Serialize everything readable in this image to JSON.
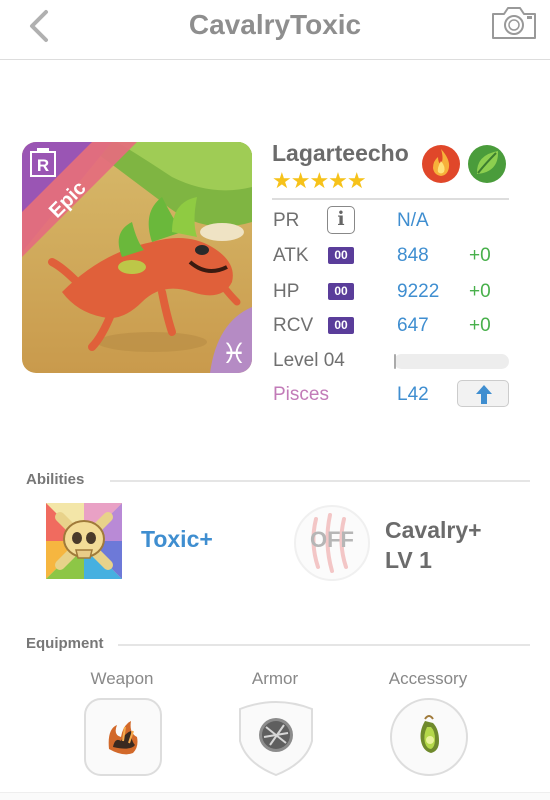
{
  "header": {
    "title": "CavalryToxic"
  },
  "monster": {
    "name": "Lagarteecho",
    "stars": "★★★★★",
    "rarity": "Epic",
    "book_badge": "R",
    "elements": [
      "fire-icon",
      "nature-icon"
    ],
    "element_colors": {
      "fire": "#e0472a",
      "nature": "#4a9c3b"
    }
  },
  "stats": {
    "pr": {
      "label": "PR",
      "info": "i",
      "value": "N/A"
    },
    "atk": {
      "label": "ATK",
      "badge": "00",
      "value": "848",
      "bonus": "+0"
    },
    "hp": {
      "label": "HP",
      "badge": "00",
      "value": "9222",
      "bonus": "+0"
    },
    "rcv": {
      "label": "RCV",
      "badge": "00",
      "value": "647",
      "bonus": "+0"
    },
    "level": {
      "label": "Level 04",
      "progress_fraction": 0.02
    },
    "sign": {
      "label": "Pisces",
      "value": "L42"
    }
  },
  "abilities": {
    "section_label": "Abilities",
    "skill_name": "Toxic+",
    "leader_status": "OFF",
    "leader_name": "Cavalry+\nLV 1"
  },
  "equipment": {
    "section_label": "Equipment",
    "slots": [
      {
        "label": "Weapon"
      },
      {
        "label": "Armor"
      },
      {
        "label": "Accessory"
      }
    ]
  },
  "colors": {
    "accent_blue": "#3f8ed0",
    "bonus_green": "#48b04b",
    "pisces": "#c27bb8",
    "badge_purple": "#5a3d9a"
  }
}
